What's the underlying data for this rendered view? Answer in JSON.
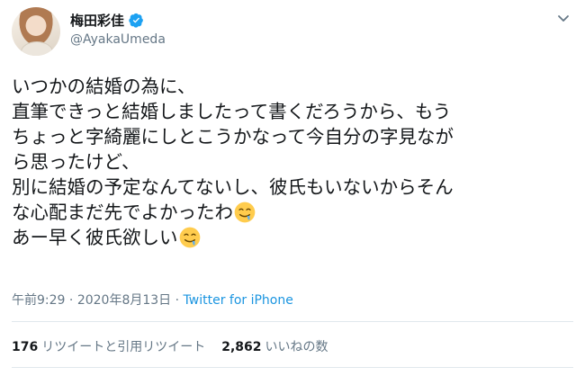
{
  "user": {
    "display_name": "梅田彩佳",
    "handle": "@AyakaUmeda",
    "verified": true
  },
  "tweet": {
    "lines": [
      "いつかの結婚の為に、",
      "直筆できっと結婚しましたって書くだろうから、もう",
      "ちょっと字綺麗にしとこうかなって今自分の字見なが",
      "ら思ったけど、",
      "別に結婚の予定なんてないし、彼氏もいないからそん",
      "な心配まだ先でよかったわ",
      "あー早く彼氏欲しい"
    ],
    "emoji": "drooling-face",
    "time": "午前9:29",
    "separator": "·",
    "date": "2020年8月13日",
    "source": "Twitter for iPhone"
  },
  "stats": {
    "retweets_count": "176",
    "retweets_label": "リツイートと引用リツイート",
    "likes_count": "2,862",
    "likes_label": "いいねの数"
  },
  "colors": {
    "text": "#14171a",
    "secondary": "#657786",
    "link": "#1b95e0",
    "verified": "#1da1f2",
    "divider": "#e1e8ed"
  }
}
